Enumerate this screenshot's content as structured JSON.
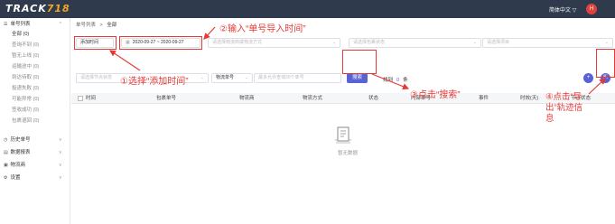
{
  "app": {
    "logo_text": "TRACK",
    "logo_num": "718",
    "lang": "简体中文 ▽",
    "avatar": "H"
  },
  "sidebar": {
    "sections": [
      {
        "label": "单号列表",
        "icon": "list-icon",
        "chevron": "^"
      },
      {
        "label": "历史单号",
        "icon": "history-icon",
        "chevron": "v"
      },
      {
        "label": "数据报表",
        "icon": "chart-icon",
        "chevron": "v"
      },
      {
        "label": "物流商",
        "icon": "truck-icon",
        "chevron": "v"
      },
      {
        "label": "设置",
        "icon": "gear-icon",
        "chevron": "v"
      }
    ],
    "subitems": [
      "全部 (0)",
      "查询不到 (0)",
      "暂无上线 (0)",
      "运输途中 (0)",
      "到达待取 (0)",
      "投递失败 (0)",
      "可能异常 (0)",
      "签收成功 (0)",
      "包裹退回 (0)"
    ]
  },
  "breadcrumb": {
    "root": "单号列表",
    "sep": ">",
    "current": "全部"
  },
  "filters": {
    "time_type": "添加时间",
    "date_range": "2020-09-27  ~ 2020-09-27",
    "carrier_placeholder": "请选择物流商或物流方式",
    "status_placeholder": "请选择包裹状态",
    "project_placeholder": "请选择项目",
    "node_placeholder": "请选择节点状态",
    "field_select": "物流单号",
    "query_placeholder": "最多允许查询20个单号"
  },
  "search": {
    "button": "搜索",
    "found_label": "找到",
    "found_count": "0",
    "found_unit": "条"
  },
  "toolbar": {
    "add_button": "+",
    "export_button": "⇱"
  },
  "table": {
    "headers": [
      "时间",
      "包裹单号",
      "物流商",
      "物流方式",
      "状态",
      "内部单号",
      "事件",
      "时效(天)",
      "节点状态"
    ]
  },
  "empty": {
    "text": "暂无数据"
  },
  "annotations": {
    "step1": "①选择“添加时间”",
    "step2": "②输入“单号导入时间”",
    "step3": "③点击“搜索”",
    "step4_line1": "④点击“导",
    "step4_line2": "出”轨迹信",
    "step4_line3": "息"
  },
  "colors": {
    "topbar": "#2f3a4d",
    "accent": "#5b63d3",
    "annotation_red": "#e53935"
  }
}
